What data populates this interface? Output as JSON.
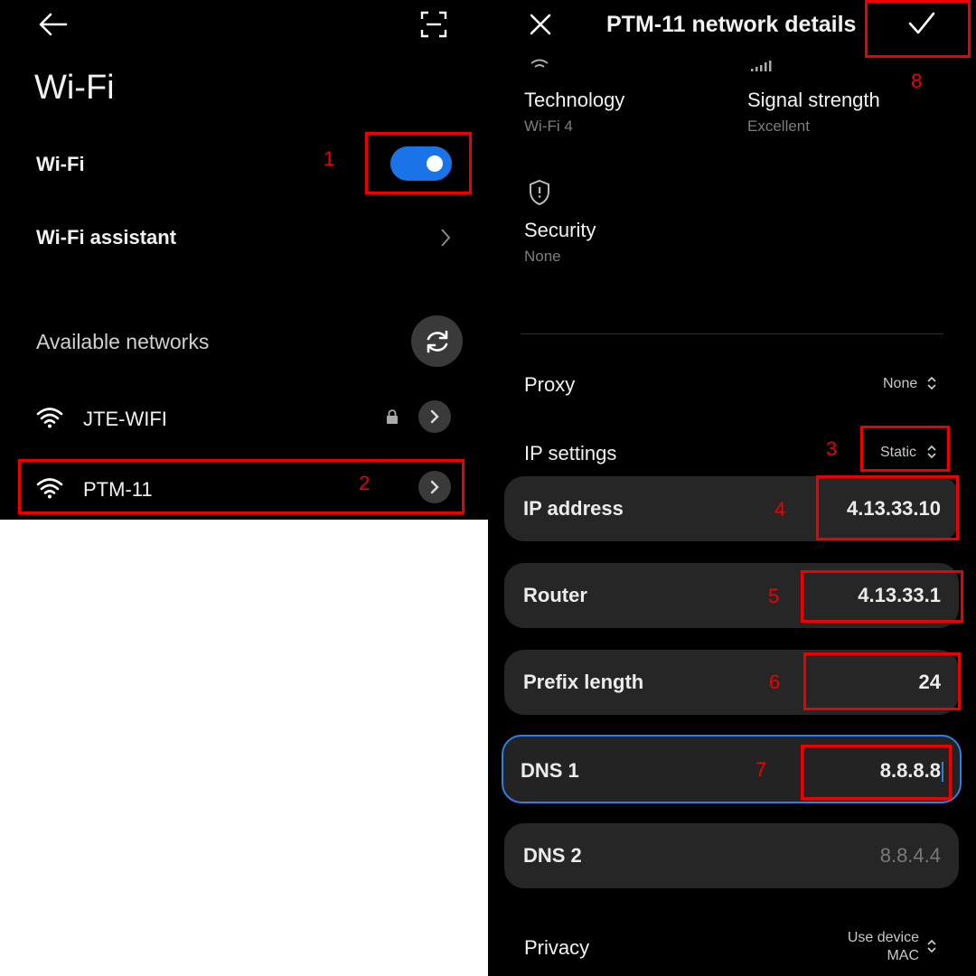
{
  "left": {
    "title": "Wi-Fi",
    "wifi_label": "Wi-Fi",
    "wifi_enabled": true,
    "assistant_label": "Wi-Fi assistant",
    "available_label": "Available networks",
    "networks": [
      {
        "name": "JTE-WIFI",
        "locked": true
      },
      {
        "name": "PTM-11",
        "locked": false
      }
    ]
  },
  "right": {
    "title": "PTM-11 network details",
    "technology": {
      "label": "Technology",
      "value": "Wi-Fi 4"
    },
    "signal": {
      "label": "Signal strength",
      "value": "Excellent"
    },
    "security": {
      "label": "Security",
      "value": "None"
    },
    "proxy": {
      "label": "Proxy",
      "value": "None"
    },
    "ip_settings": {
      "label": "IP settings",
      "value": "Static"
    },
    "fields": {
      "ip": {
        "label": "IP address",
        "value": "4.13.33.10"
      },
      "router": {
        "label": "Router",
        "value": "4.13.33.1"
      },
      "prefix": {
        "label": "Prefix length",
        "value": "24"
      },
      "dns1": {
        "label": "DNS 1",
        "value": "8.8.8.8"
      },
      "dns2": {
        "label": "DNS 2",
        "placeholder": "8.8.4.4"
      }
    },
    "privacy": {
      "label": "Privacy",
      "value_line1": "Use device",
      "value_line2": "MAC"
    }
  },
  "annotations": [
    "1",
    "2",
    "3",
    "4",
    "5",
    "6",
    "7",
    "8"
  ],
  "colors": {
    "accent": "#1b73e8",
    "annotation": "#e00000",
    "focus": "#2f7fe6"
  },
  "icons": [
    "back-arrow-icon",
    "scan-icon",
    "refresh-icon",
    "wifi-icon",
    "lock-icon",
    "chevron-right-icon",
    "close-icon",
    "check-icon",
    "signal-bars-icon",
    "shield-icon",
    "updown-icon"
  ]
}
